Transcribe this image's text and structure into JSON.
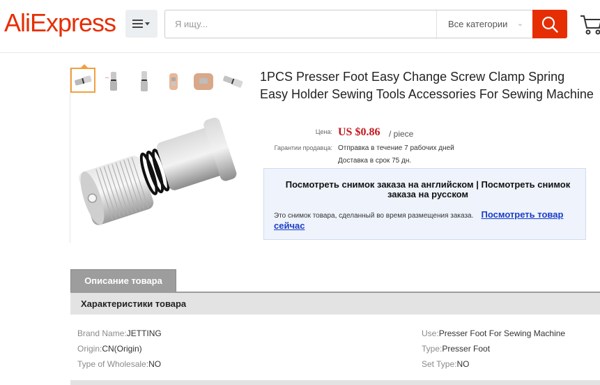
{
  "header": {
    "logo": "AliExpress",
    "search_placeholder": "Я ищу...",
    "category_select": "Все категории",
    "brand_color": "#e62e04"
  },
  "product": {
    "title": "1PCS Presser Foot Easy Change Screw Clamp Spring Easy Holder Sewing Tools Accessories For Sewing Machine",
    "price_label": "Цена:",
    "price": "US $0.86",
    "price_unit": "/ piece",
    "guarantee_label": "Гарантии продавца:",
    "dispatch": "Отправка в течение 7 рабочих дней",
    "delivery": "Доставка в срок 75 дн."
  },
  "snapshot": {
    "english_link": "Посмотреть снимок заказа на английском",
    "separator": "|",
    "russian_link": "Посмотреть снимок заказа на русском",
    "note": "Это снимок товара, сделанный во время размещения заказа.",
    "view_now_link": "Посмотреть товар сейчас"
  },
  "description": {
    "tab_label": "Описание товара",
    "specs_header": "Характеристики товара",
    "specs_left": [
      {
        "key": "Brand Name:",
        "value": "JETTING"
      },
      {
        "key": "Origin:",
        "value": "CN(Origin)"
      },
      {
        "key": "Type of Wholesale:",
        "value": "NO"
      }
    ],
    "specs_right": [
      {
        "key": "Use:",
        "value": "Presser Foot For Sewing Machine"
      },
      {
        "key": "Type:",
        "value": "Presser Foot"
      },
      {
        "key": "Set Type:",
        "value": "NO"
      }
    ]
  },
  "gallery": {
    "thumbnail_count": 6,
    "active_thumbnail": 1
  }
}
